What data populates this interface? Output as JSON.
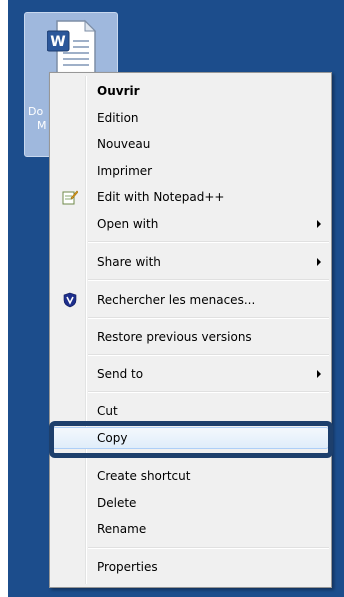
{
  "desktop": {
    "icon_label_lines": [
      "Do",
      "M",
      "·"
    ]
  },
  "menu": {
    "items": [
      {
        "label": "Ouvrir",
        "bold": true
      },
      {
        "label": "Edition"
      },
      {
        "label": "Nouveau"
      },
      {
        "label": "Imprimer"
      },
      {
        "label": "Edit with Notepad++",
        "icon": "notepad-plus-plus-icon"
      },
      {
        "label": "Open with",
        "submenu": true
      },
      {
        "label": "Share with",
        "submenu": true
      },
      {
        "label": "Rechercher les menaces...",
        "icon": "shield-icon"
      },
      {
        "label": "Restore previous versions"
      },
      {
        "label": "Send to",
        "submenu": true
      },
      {
        "label": "Cut"
      },
      {
        "label": "Copy",
        "highlighted": true
      },
      {
        "label": "Create shortcut"
      },
      {
        "label": "Delete"
      },
      {
        "label": "Rename"
      },
      {
        "label": "Properties"
      }
    ]
  },
  "colors": {
    "desktop_background": "#1c4d8c",
    "menu_background": "#f0f0f0",
    "highlight_border": "#aecff7",
    "focus_ring": "#1d3f6c"
  }
}
